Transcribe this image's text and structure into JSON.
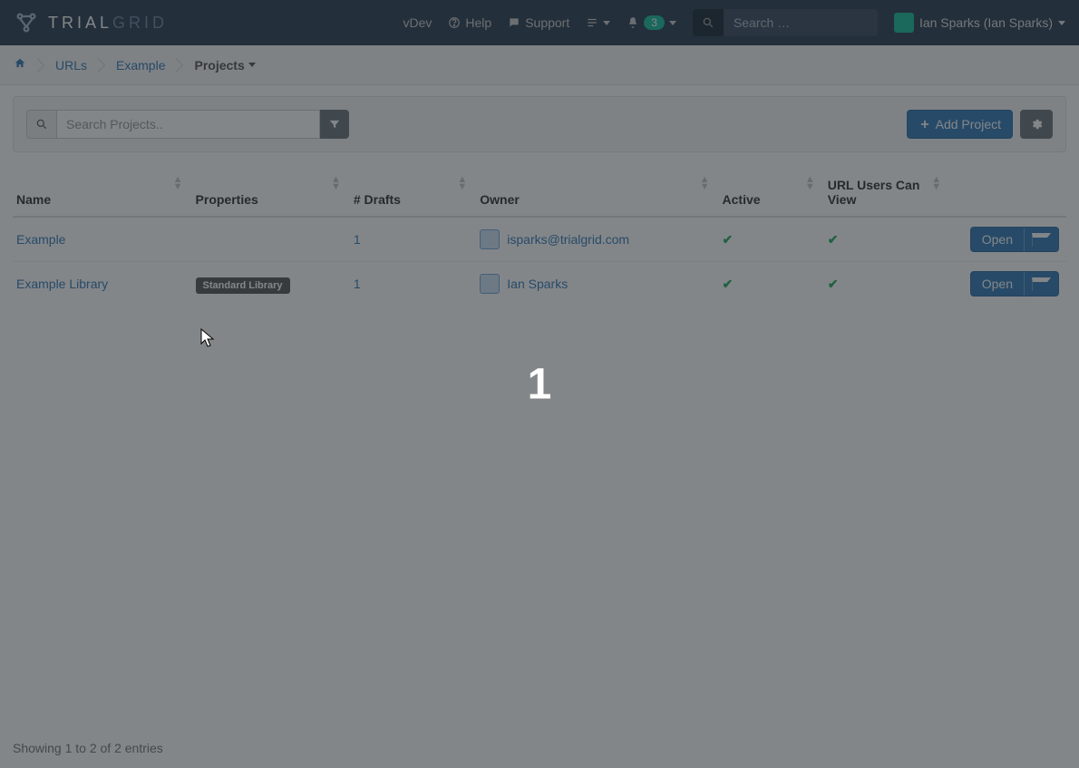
{
  "nav": {
    "brand_a": "TRIAL",
    "brand_b": "GRID",
    "vdev": "vDev",
    "help": "Help",
    "support": "Support",
    "notif_count": "3",
    "search_ph": "Search …",
    "user": "Ian Sparks (Ian Sparks)"
  },
  "breadcrumb": {
    "urls": "URLs",
    "example": "Example",
    "projects": "Projects"
  },
  "toolbar": {
    "search_ph": "Search Projects..",
    "add": "Add Project"
  },
  "columns": {
    "name": "Name",
    "properties": "Properties",
    "drafts": "# Drafts",
    "owner": "Owner",
    "active": "Active",
    "urlusers": "URL Users Can View"
  },
  "rows": [
    {
      "name": "Example",
      "property": "",
      "drafts": "1",
      "owner": "isparks@trialgrid.com",
      "active": true,
      "can_view": true,
      "open": "Open"
    },
    {
      "name": "Example Library",
      "property": "Standard Library",
      "drafts": "1",
      "owner": "Ian Sparks",
      "active": true,
      "can_view": true,
      "open": "Open"
    }
  ],
  "footer": "Showing 1 to 2 of 2 entries",
  "overlay_number": "1"
}
